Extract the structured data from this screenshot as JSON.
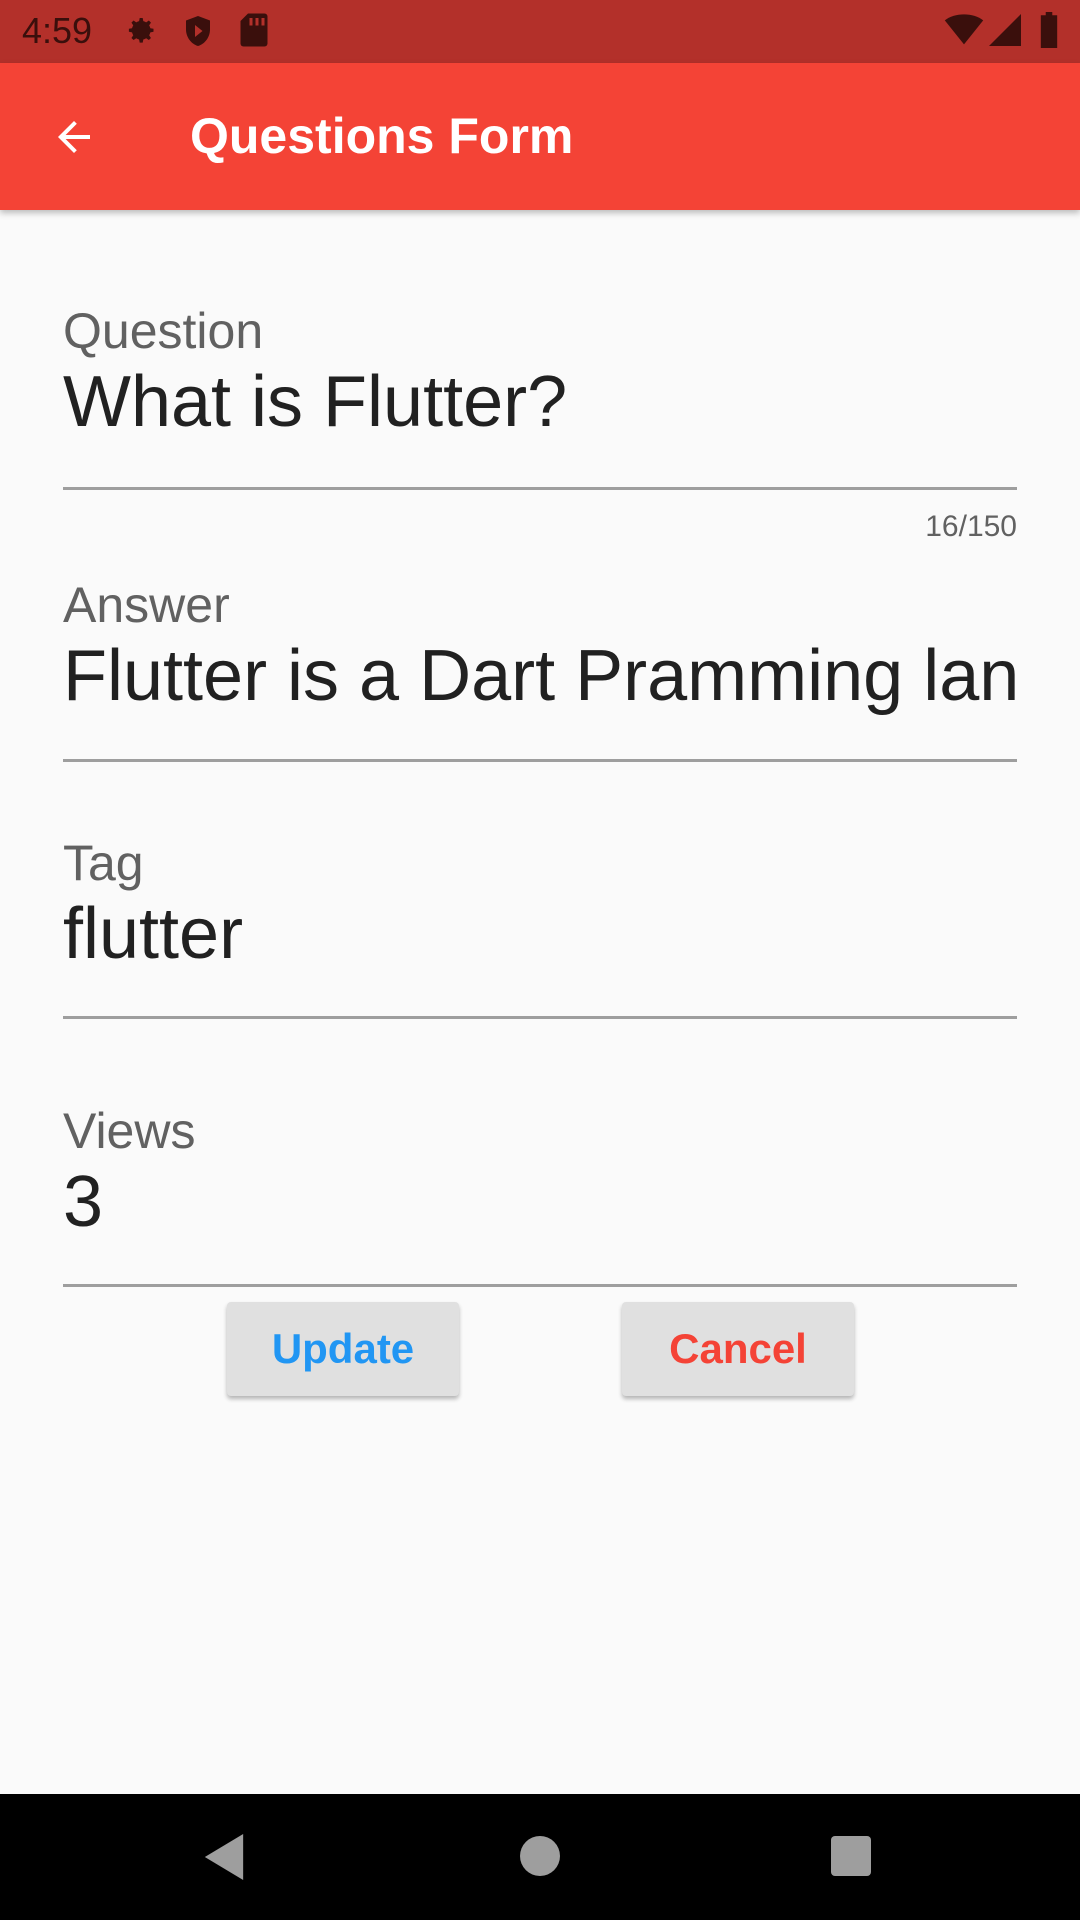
{
  "status_bar": {
    "time": "4:59",
    "icons_left": [
      "gear-icon",
      "shield-icon",
      "sd-card-icon"
    ],
    "icons_right": [
      "wifi-icon",
      "signal-icon",
      "battery-icon"
    ]
  },
  "app_bar": {
    "title": "Questions Form",
    "back_icon": "arrow-back-icon",
    "color": "#f44336"
  },
  "form": {
    "question": {
      "label": "Question",
      "value": "What is Flutter?",
      "counter": "16/150"
    },
    "answer": {
      "label": "Answer",
      "value": "Flutter is a Dart Pramming language"
    },
    "tag": {
      "label": "Tag",
      "value": "flutter"
    },
    "views": {
      "label": "Views",
      "value": "3"
    }
  },
  "buttons": {
    "update": {
      "label": "Update",
      "color": "#2196f3"
    },
    "cancel": {
      "label": "Cancel",
      "color": "#f44336"
    }
  },
  "nav_bar": {
    "icons": [
      "back-triangle-icon",
      "home-circle-icon",
      "recents-square-icon"
    ]
  }
}
